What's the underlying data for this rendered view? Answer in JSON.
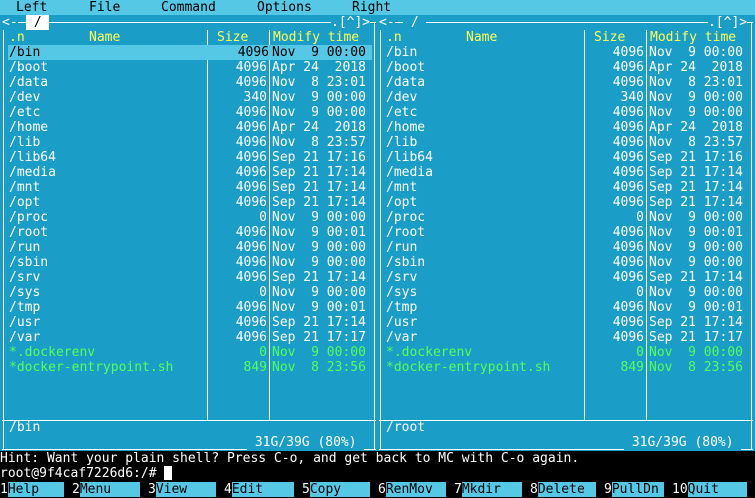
{
  "menu": [
    "Left",
    "File",
    "Command",
    "Options",
    "Right"
  ],
  "left_panel": {
    "path_title": " / ",
    "corner": ".[^]>",
    "headers": {
      "sort": ".n",
      "name": "Name",
      "size": "Size",
      "time": "Modify time"
    },
    "status_path": "/bin",
    "free_space": "31G/39G (80%)",
    "selected_index": 0,
    "files": [
      {
        "name": "/bin",
        "size": "4096",
        "time": "Nov  9 00:00",
        "type": "dir"
      },
      {
        "name": "/boot",
        "size": "4096",
        "time": "Apr 24  2018",
        "type": "dir"
      },
      {
        "name": "/data",
        "size": "4096",
        "time": "Nov  8 23:01",
        "type": "dir"
      },
      {
        "name": "/dev",
        "size": "340",
        "time": "Nov  9 00:00",
        "type": "dir"
      },
      {
        "name": "/etc",
        "size": "4096",
        "time": "Nov  9 00:00",
        "type": "dir"
      },
      {
        "name": "/home",
        "size": "4096",
        "time": "Apr 24  2018",
        "type": "dir"
      },
      {
        "name": "/lib",
        "size": "4096",
        "time": "Nov  8 23:57",
        "type": "dir"
      },
      {
        "name": "/lib64",
        "size": "4096",
        "time": "Sep 21 17:16",
        "type": "dir"
      },
      {
        "name": "/media",
        "size": "4096",
        "time": "Sep 21 17:14",
        "type": "dir"
      },
      {
        "name": "/mnt",
        "size": "4096",
        "time": "Sep 21 17:14",
        "type": "dir"
      },
      {
        "name": "/opt",
        "size": "4096",
        "time": "Sep 21 17:14",
        "type": "dir"
      },
      {
        "name": "/proc",
        "size": "0",
        "time": "Nov  9 00:00",
        "type": "dir"
      },
      {
        "name": "/root",
        "size": "4096",
        "time": "Nov  9 00:01",
        "type": "dir"
      },
      {
        "name": "/run",
        "size": "4096",
        "time": "Nov  9 00:00",
        "type": "dir"
      },
      {
        "name": "/sbin",
        "size": "4096",
        "time": "Nov  9 00:00",
        "type": "dir"
      },
      {
        "name": "/srv",
        "size": "4096",
        "time": "Sep 21 17:14",
        "type": "dir"
      },
      {
        "name": "/sys",
        "size": "0",
        "time": "Nov  9 00:00",
        "type": "dir"
      },
      {
        "name": "/tmp",
        "size": "4096",
        "time": "Nov  9 00:01",
        "type": "dir"
      },
      {
        "name": "/usr",
        "size": "4096",
        "time": "Sep 21 17:14",
        "type": "dir"
      },
      {
        "name": "/var",
        "size": "4096",
        "time": "Sep 21 17:17",
        "type": "dir"
      },
      {
        "name": "*.dockerenv",
        "size": "0",
        "time": "Nov  9 00:00",
        "type": "exec"
      },
      {
        "name": "*docker-entrypoint.sh",
        "size": "849",
        "time": "Nov  8 23:56",
        "type": "exec"
      }
    ]
  },
  "right_panel": {
    "path_title": " / ",
    "corner": ".[^]>",
    "headers": {
      "sort": ".n",
      "name": "Name",
      "size": "Size",
      "time": "Modify time"
    },
    "status_path": "/root",
    "free_space": "31G/39G (80%)",
    "selected_index": -1,
    "files": [
      {
        "name": "/bin",
        "size": "4096",
        "time": "Nov  9 00:00",
        "type": "dir"
      },
      {
        "name": "/boot",
        "size": "4096",
        "time": "Apr 24  2018",
        "type": "dir"
      },
      {
        "name": "/data",
        "size": "4096",
        "time": "Nov  8 23:01",
        "type": "dir"
      },
      {
        "name": "/dev",
        "size": "340",
        "time": "Nov  9 00:00",
        "type": "dir"
      },
      {
        "name": "/etc",
        "size": "4096",
        "time": "Nov  9 00:00",
        "type": "dir"
      },
      {
        "name": "/home",
        "size": "4096",
        "time": "Apr 24  2018",
        "type": "dir"
      },
      {
        "name": "/lib",
        "size": "4096",
        "time": "Nov  8 23:57",
        "type": "dir"
      },
      {
        "name": "/lib64",
        "size": "4096",
        "time": "Sep 21 17:16",
        "type": "dir"
      },
      {
        "name": "/media",
        "size": "4096",
        "time": "Sep 21 17:14",
        "type": "dir"
      },
      {
        "name": "/mnt",
        "size": "4096",
        "time": "Sep 21 17:14",
        "type": "dir"
      },
      {
        "name": "/opt",
        "size": "4096",
        "time": "Sep 21 17:14",
        "type": "dir"
      },
      {
        "name": "/proc",
        "size": "0",
        "time": "Nov  9 00:00",
        "type": "dir"
      },
      {
        "name": "/root",
        "size": "4096",
        "time": "Nov  9 00:01",
        "type": "dir"
      },
      {
        "name": "/run",
        "size": "4096",
        "time": "Nov  9 00:00",
        "type": "dir"
      },
      {
        "name": "/sbin",
        "size": "4096",
        "time": "Nov  9 00:00",
        "type": "dir"
      },
      {
        "name": "/srv",
        "size": "4096",
        "time": "Sep 21 17:14",
        "type": "dir"
      },
      {
        "name": "/sys",
        "size": "0",
        "time": "Nov  9 00:00",
        "type": "dir"
      },
      {
        "name": "/tmp",
        "size": "4096",
        "time": "Nov  9 00:01",
        "type": "dir"
      },
      {
        "name": "/usr",
        "size": "4096",
        "time": "Sep 21 17:14",
        "type": "dir"
      },
      {
        "name": "/var",
        "size": "4096",
        "time": "Sep 21 17:17",
        "type": "dir"
      },
      {
        "name": "*.dockerenv",
        "size": "0",
        "time": "Nov  9 00:00",
        "type": "exec"
      },
      {
        "name": "*docker-entrypoint.sh",
        "size": "849",
        "time": "Nov  8 23:56",
        "type": "exec"
      }
    ]
  },
  "hint": "Hint: Want your plain shell? Press C-o, and get back to MC with C-o again.",
  "prompt": "root@9f4caf7226d6:/# ",
  "fkeys": [
    {
      "num": "1",
      "label": "Help"
    },
    {
      "num": "2",
      "label": "Menu"
    },
    {
      "num": "3",
      "label": "View"
    },
    {
      "num": "4",
      "label": "Edit"
    },
    {
      "num": "5",
      "label": "Copy"
    },
    {
      "num": "6",
      "label": "RenMov"
    },
    {
      "num": "7",
      "label": "Mkdir"
    },
    {
      "num": "8",
      "label": "Delete"
    },
    {
      "num": "9",
      "label": "PullDn"
    },
    {
      "num": "10",
      "label": "Quit"
    }
  ],
  "colors": {
    "panel_bg": "#1a9ec8",
    "menu_bg": "#55c8e6",
    "header_fg": "#ffff55",
    "exec_fg": "#55ff55"
  }
}
